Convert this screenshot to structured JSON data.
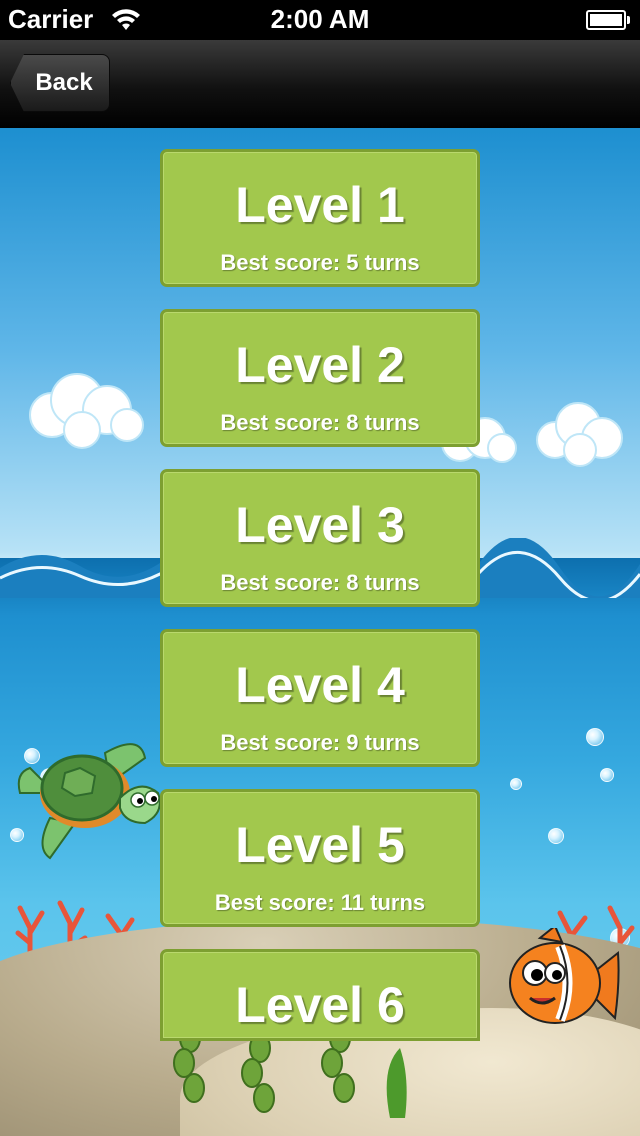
{
  "status_bar": {
    "carrier": "Carrier",
    "time": "2:00 AM"
  },
  "nav": {
    "back_label": "Back"
  },
  "levels": [
    {
      "title": "Level 1",
      "score": "Best score: 5 turns"
    },
    {
      "title": "Level 2",
      "score": "Best score: 8 turns"
    },
    {
      "title": "Level 3",
      "score": "Best score: 8 turns"
    },
    {
      "title": "Level 4",
      "score": "Best score: 9 turns"
    },
    {
      "title": "Level 5",
      "score": "Best score: 11 turns"
    },
    {
      "title": "Level 6"
    }
  ],
  "colors": {
    "level_button": "#a2c84d",
    "level_button_border": "#7d9f31",
    "sky": "#5fb6e8",
    "sea": "#35a8df",
    "sand": "#dcd0b3"
  },
  "icons": [
    "wifi-icon",
    "battery-icon",
    "back-chevron-icon",
    "turtle-icon",
    "clownfish-icon"
  ]
}
